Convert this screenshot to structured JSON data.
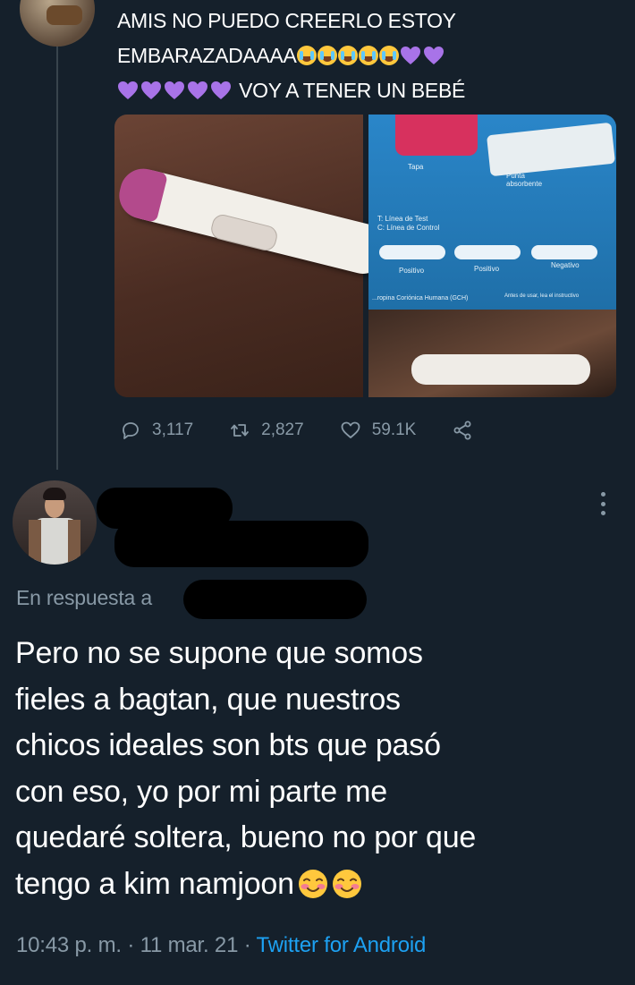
{
  "original_tweet": {
    "text_line1": "AMIS NO PUEDO CREERLO ESTOY",
    "text_line2": "EMBARAZADAAAA",
    "text_line3": "VOY A TENER UN BEBÉ",
    "emojis": [
      "loudly-crying-face",
      "purple-heart"
    ],
    "photos": {
      "right_photo_labels": {
        "tapa": "Tapa",
        "punta": "Punta absorbente",
        "legend_t": "T: Línea de Test",
        "legend_c": "C: Línea de Control",
        "positivo_1": "Positivo",
        "positivo_2": "Positivo",
        "negativo": "Negativo",
        "hormona": "...ropina Coriónica Humana (GCH)",
        "instrucciones": "Antes de usar, lea el instructivo"
      }
    },
    "actions": {
      "replies": "3,117",
      "retweets": "2,827",
      "likes": "59.1K"
    }
  },
  "reply_tweet": {
    "reply_prefix": "En respuesta a",
    "text_line1": "Pero no se supone que somos",
    "text_line2": "fieles a bagtan, que nuestros",
    "text_line3": "chicos ideales son bts que pasó",
    "text_line4": "con eso, yo por mi parte me",
    "text_line5": "quedaré soltera, bueno no por que",
    "text_line6": "tengo a kim namjoon",
    "emoji": "smiling-face-with-smiling-eyes",
    "time": "10:43 p. m.",
    "date": "11 mar. 21",
    "source": "Twitter for Android"
  },
  "colors": {
    "background": "#15202b",
    "muted": "#8899a6",
    "link": "#1da1f2",
    "purple_heart": "#a873e8",
    "thread_line": "#38444d"
  }
}
